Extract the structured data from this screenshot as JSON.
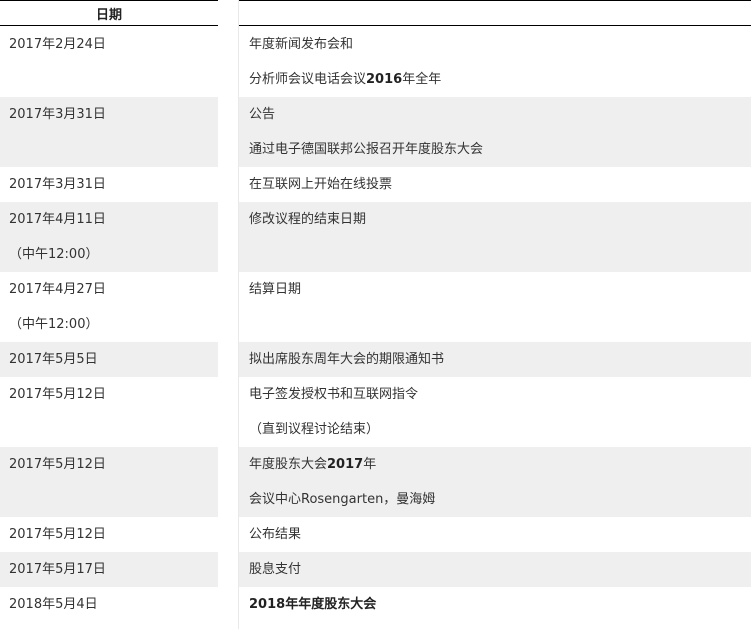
{
  "header": {
    "date_label": "日期",
    "event_label": ""
  },
  "rows": [
    {
      "date": [
        "2017年2月24日"
      ],
      "event": [
        [
          {
            "text": "年度新闻发布会和",
            "bold": false
          }
        ],
        [
          {
            "text": "分析师会议电话会议",
            "bold": false
          },
          {
            "text": "2016",
            "bold": true
          },
          {
            "text": "年全年",
            "bold": false
          }
        ]
      ]
    },
    {
      "date": [
        "2017年3月31日"
      ],
      "event": [
        [
          {
            "text": "公告",
            "bold": false
          }
        ],
        [
          {
            "text": "通过电子德国联邦公报召开年度股东大会",
            "bold": false
          }
        ]
      ]
    },
    {
      "date": [
        "2017年3月31日"
      ],
      "event": [
        [
          {
            "text": "在互联网上开始在线投票",
            "bold": false
          }
        ]
      ]
    },
    {
      "date": [
        "2017年4月11日",
        "（中午12:00）"
      ],
      "event": [
        [
          {
            "text": "修改议程的结束日期",
            "bold": false
          }
        ]
      ]
    },
    {
      "date": [
        "2017年4月27日",
        "（中午12:00）"
      ],
      "event": [
        [
          {
            "text": "结算日期",
            "bold": false
          }
        ]
      ]
    },
    {
      "date": [
        "2017年5月5日"
      ],
      "event": [
        [
          {
            "text": "拟出席股东周年大会的期限通知书",
            "bold": false
          }
        ]
      ]
    },
    {
      "date": [
        "2017年5月12日"
      ],
      "event": [
        [
          {
            "text": "电子签发授权书和互联网指令",
            "bold": false
          }
        ],
        [
          {
            "text": "（直到议程讨论结束）",
            "bold": false
          }
        ]
      ]
    },
    {
      "date": [
        "2017年5月12日"
      ],
      "event": [
        [
          {
            "text": "年度股东大会",
            "bold": false
          },
          {
            "text": "2017",
            "bold": true
          },
          {
            "text": "年",
            "bold": false
          }
        ],
        [
          {
            "text": "会议中心Rosengarten，曼海姆",
            "bold": false
          }
        ]
      ]
    },
    {
      "date": [
        "2017年5月12日"
      ],
      "event": [
        [
          {
            "text": "公布结果",
            "bold": false
          }
        ]
      ]
    },
    {
      "date": [
        "2017年5月17日"
      ],
      "event": [
        [
          {
            "text": "股息支付",
            "bold": false
          }
        ]
      ]
    },
    {
      "date": [
        "2018年5月4日"
      ],
      "event": [
        [
          {
            "text": "2018",
            "bold": true
          },
          {
            "text": "年年度股东大会",
            "bold": true
          }
        ]
      ]
    }
  ],
  "colors": {
    "shade": "#efefef",
    "text": "#333333",
    "rule": "#000000"
  }
}
